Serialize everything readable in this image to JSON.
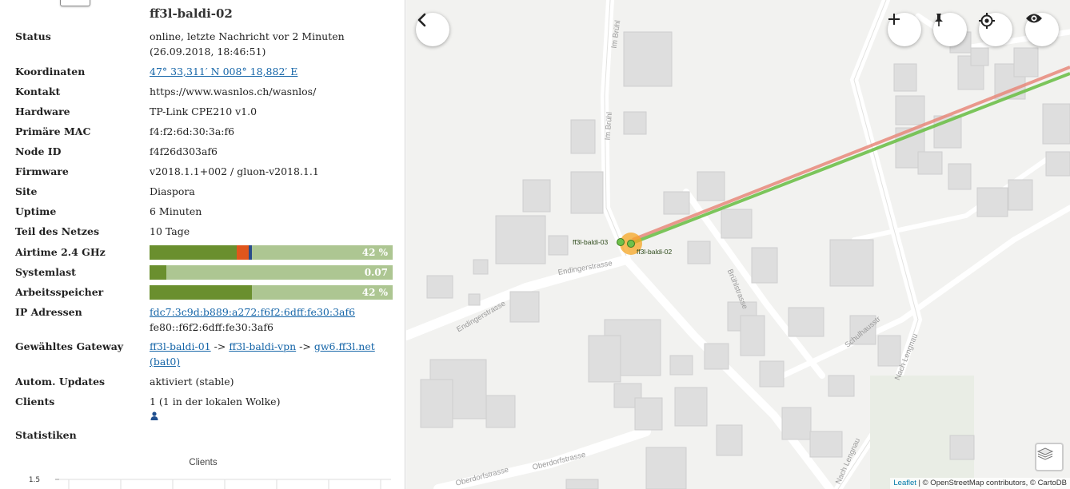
{
  "node": {
    "title": "ff3l-baldi-02",
    "status_label": "Status",
    "status_line1": "online, letzte Nachricht vor 2 Minuten",
    "status_line2": "(26.09.2018, 18:46:51)",
    "coords_label": "Koordinaten",
    "coords_value": "47° 33,311′ N 008° 18,882′ E",
    "contact_label": "Kontakt",
    "contact_value": "https://www.wasnlos.ch/wasnlos/",
    "hardware_label": "Hardware",
    "hardware_value": "TP-Link CPE210 v1.0",
    "mac_label": "Primäre MAC",
    "mac_value": "f4:f2:6d:30:3a:f6",
    "nodeid_label": "Node ID",
    "nodeid_value": "f4f26d303af6",
    "firmware_label": "Firmware",
    "firmware_value": "v2018.1.1+002 / gluon-v2018.1.1",
    "site_label": "Site",
    "site_value": "Diaspora",
    "uptime_label": "Uptime",
    "uptime_value": "6 Minuten",
    "network_label": "Teil des Netzes",
    "network_value": "10 Tage",
    "airtime_label": "Airtime 2.4 GHz",
    "airtime_pct": "42 %",
    "airtime_fraction": 0.42,
    "load_label": "Systemlast",
    "load_value": "0.07",
    "load_fraction": 0.07,
    "memory_label": "Arbeitsspeicher",
    "memory_pct": "42 %",
    "memory_fraction": 0.42,
    "ip_label": "IP Adressen",
    "ip1": "fdc7:3c9d:b889:a272:f6f2:6dff:fe30:3af6",
    "ip2": "fe80::f6f2:6dff:fe30:3af6",
    "gateway_label": "Gewähltes Gateway",
    "gw_hop1": "ff3l-baldi-01",
    "gw_sep": "->",
    "gw_hop2": "ff3l-baldi-vpn",
    "gw_hop3": "gw6.ff3l.net",
    "gw_iface": "(bat0)",
    "updates_label": "Autom. Updates",
    "updates_value": "aktiviert (stable)",
    "clients_label": "Clients",
    "clients_value": "1 (1 in der lokalen Wolke)",
    "stats_label": "Statistiken",
    "chart_title": "Clients",
    "chart_ytick": "1.5"
  },
  "colors": {
    "status_green": "#4a7d1e",
    "bar_dark": "#6a8f2e",
    "bar_light": "#adc692",
    "airtime_orange": "#e0561c",
    "airtime_blue": "#2a4d8a",
    "link_blue": "#1565a8",
    "link_green": "#6ec04a",
    "link_red": "#e8887a"
  },
  "map": {
    "node_a_label": "ff3l-baldi-03",
    "node_b_label": "ff3l-baldi-02",
    "streets": {
      "im_bruehl_1": "Im Brühl",
      "im_bruehl_2": "Im Brühl",
      "endingerstrasse_1": "Endingerstrasse",
      "endingerstrasse_2": "Endingerstrasse",
      "bruehlstrasse": "Brühlstrasse",
      "schulhausstr": "Schulhausstr",
      "nach_lengnau_1": "Nach Lengnau",
      "nach_lengnau_2": "Nach Lengnau",
      "oberdorfstrasse_1": "Oberdorfstrasse",
      "oberdorfstrasse_2": "Oberdorfstrasse"
    },
    "attribution": {
      "leaflet": "Leaflet",
      "rest": " | © OpenStreetMap contributors, © CartoDB"
    },
    "buttons": [
      "back-icon",
      "plus-icon",
      "pin-icon",
      "locate-icon",
      "eye-icon",
      "layers-icon"
    ]
  }
}
